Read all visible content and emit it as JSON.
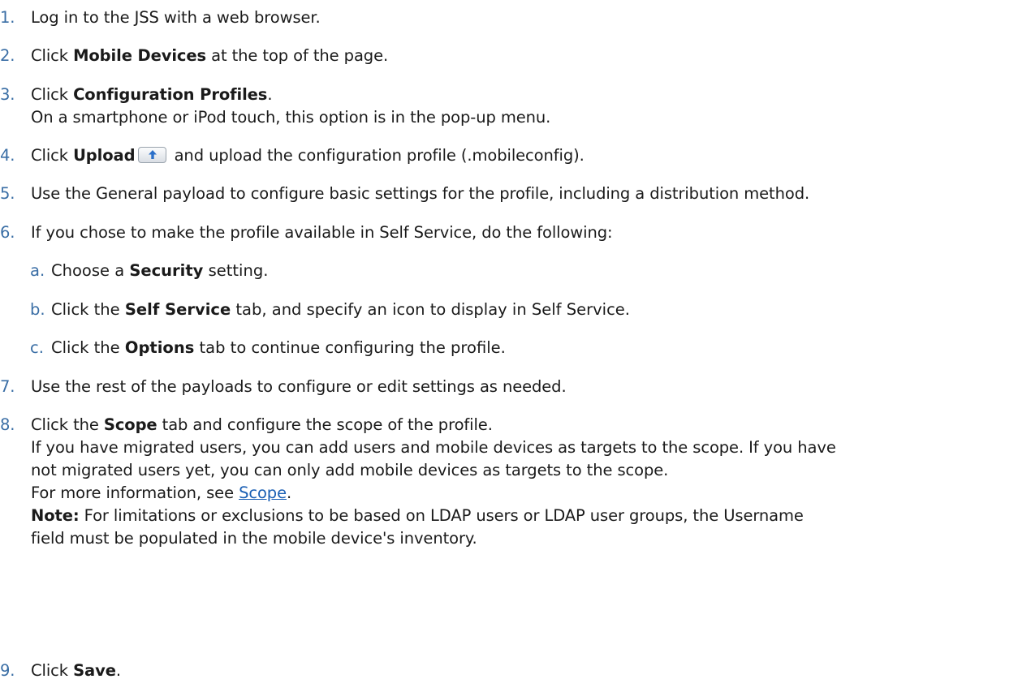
{
  "steps": [
    {
      "num": "1.",
      "text": "Log in to the JSS with a web browser."
    },
    {
      "num": "2.",
      "pre": "Click ",
      "bold": "Mobile Devices",
      "post": " at the top of the page."
    },
    {
      "num": "3.",
      "pre": "Click ",
      "bold": "Configuration Profiles",
      "post": ".",
      "note": "On a smartphone or iPod touch, this option is in the pop-up menu."
    },
    {
      "num": "4.",
      "pre": "Click ",
      "bold": "Upload",
      "post": " and upload the configuration profile (.mobileconfig).",
      "icon": "upload-arrow-icon"
    },
    {
      "num": "5.",
      "text": "Use the General payload to configure basic settings for the profile, including a distribution method."
    },
    {
      "num": "6.",
      "text": "If you chose to make the profile available in Self Service, do the following:",
      "substeps": [
        {
          "num": "a.",
          "pre": "Choose a ",
          "bold": "Security",
          "post": " setting."
        },
        {
          "num": "b.",
          "pre": "Click the ",
          "bold": "Self Service",
          "post": " tab, and specify an icon to display in Self Service."
        },
        {
          "num": "c.",
          "pre": "Click the ",
          "bold": "Options",
          "post": " tab to continue configuring the profile."
        }
      ]
    },
    {
      "num": "7.",
      "text": "Use the rest of the payloads to configure or edit settings as needed."
    },
    {
      "num": "8.",
      "pre": "Click the ",
      "bold": "Scope",
      "post": " tab and configure the scope of the profile.",
      "para1_line1": "If you have migrated users, you can add users and mobile devices as targets to the scope. If you have",
      "para1_line2": "not migrated users yet, you can only add mobile devices as targets to the scope.",
      "more_pre": "For more information, see ",
      "more_link": "Scope",
      "more_post": ".",
      "note_label": "Note:",
      "note_line1": " For limitations or exclusions to be based on LDAP users or LDAP user groups, the Username",
      "note_line2": "field must be populated in the mobile device's inventory."
    },
    {
      "num": "9.",
      "pre": "Click ",
      "bold": "Save",
      "post": "."
    }
  ]
}
